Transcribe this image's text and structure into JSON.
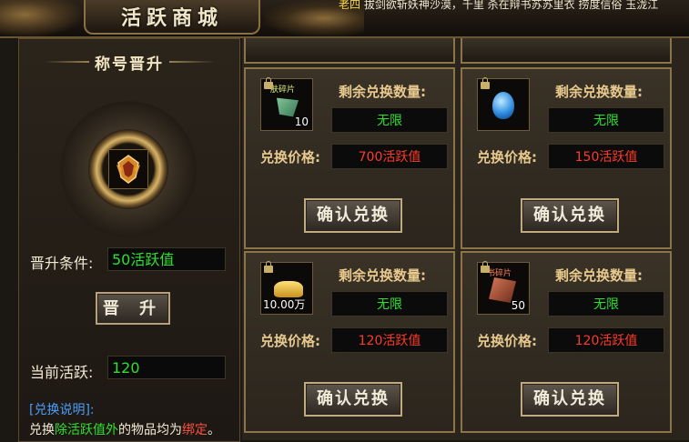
{
  "header": {
    "title": "活跃商城",
    "marquee_prefix": "老四",
    "marquee_text": "拔剑欲斩妖神沙漠，千里 杀在辩书苏苏里衣 捞度信俗 玉泷江"
  },
  "left_panel": {
    "title": "称号晋升",
    "emblem_icon": "title-emblem-icon",
    "condition_label": "晋升条件:",
    "condition_value": "50活跃值",
    "promote_button": "晋 升",
    "current_label": "当前活跃:",
    "current_value": "120",
    "note_title": "[兑换说明]:",
    "note_prefix": "兑换",
    "note_green": "除活跃值外",
    "note_mid": "的物品均为",
    "note_red": "绑定",
    "note_end": "。"
  },
  "cards": [
    {
      "icon": "shard-fragment-icon",
      "tag": "肤碎片",
      "qty": "10",
      "remaining_label": "剩余兑换数量:",
      "remaining_value": "无限",
      "price_label": "兑换价格:",
      "price_value": "700活跃值",
      "button": "确认兑换"
    },
    {
      "icon": "blue-gem-icon",
      "tag": "",
      "qty": "",
      "remaining_label": "剩余兑换数量:",
      "remaining_value": "无限",
      "price_label": "兑换价格:",
      "price_value": "150活跃值",
      "button": "确认兑换"
    },
    {
      "icon": "gold-ingot-icon",
      "tag": "",
      "qty": "10.00万",
      "remaining_label": "剩余兑换数量:",
      "remaining_value": "无限",
      "price_label": "兑换价格:",
      "price_value": "120活跃值",
      "button": "确认兑换"
    },
    {
      "icon": "skill-book-fragment-icon",
      "tag": "书碎片",
      "qty": "50",
      "remaining_label": "剩余兑换数量:",
      "remaining_value": "无限",
      "price_label": "兑换价格:",
      "price_value": "120活跃值",
      "button": "确认兑换"
    }
  ],
  "colors": {
    "accent_green": "#2fe02f",
    "accent_red": "#ff3a2a",
    "label_gold": "#e7c98e",
    "note_blue": "#4a9ef5"
  }
}
